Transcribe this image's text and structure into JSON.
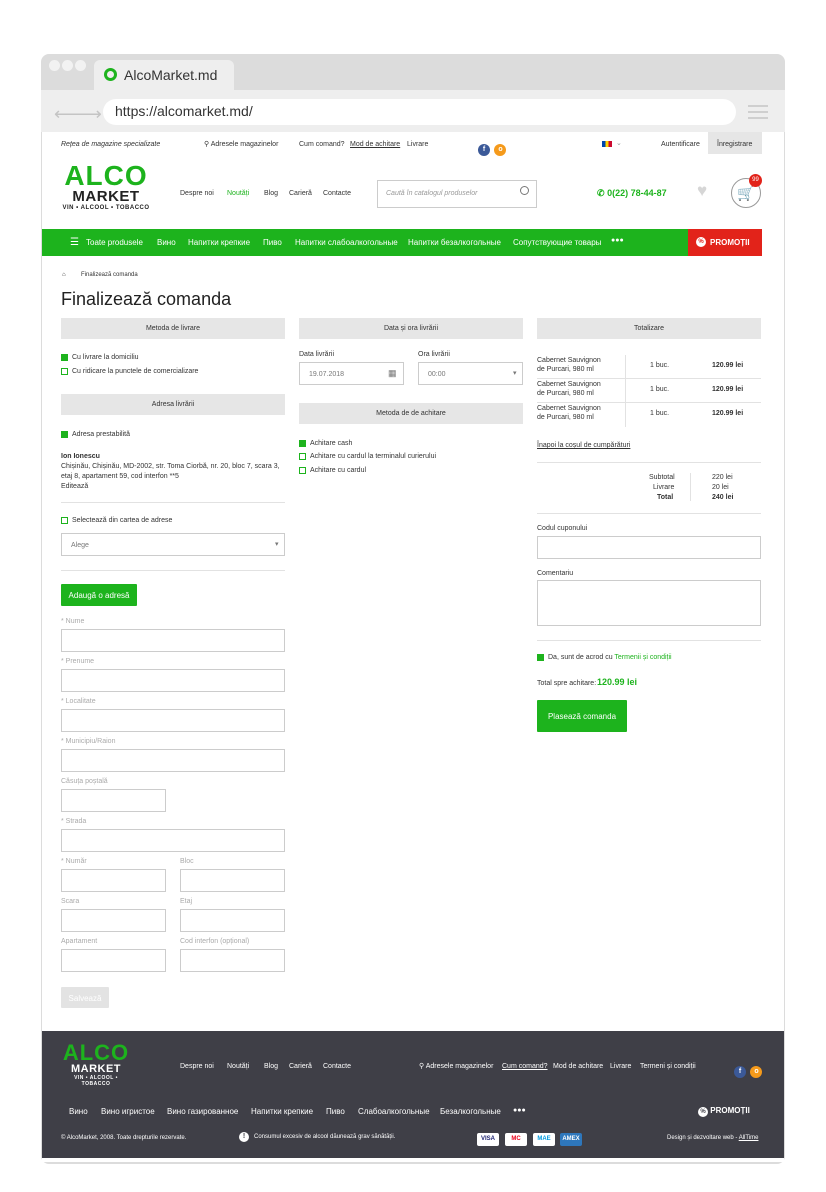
{
  "browser": {
    "tab_title": "AlcoMarket.md",
    "url": "https://alcomarket.md/"
  },
  "topbar": {
    "tagline": "Rețea de magazine specializate",
    "stores": "Adresele magazinelor",
    "links": [
      "Cum comand?",
      "Mod de achitare",
      "Livrare"
    ],
    "login": "Autentificare",
    "register": "Înregistrare"
  },
  "logo": {
    "alco": "ALCO",
    "market": "MARKET",
    "sub": "VIN • ALCOOL • TOBACCO"
  },
  "header": {
    "nav": [
      "Despre noi",
      "Noutăți",
      "Blog",
      "Carieră",
      "Contacte"
    ],
    "search_placeholder": "Caută în catalogul produselor",
    "phone": "0(22) 78-44-87",
    "cart_count": "99"
  },
  "menu": {
    "all_products": "Toate produsele",
    "items": [
      "Вино",
      "Напитки крепкие",
      "Пиво",
      "Напитки слабоалкогольные",
      "Напитки безалкогольные",
      "Сопутствующие товары"
    ],
    "more": "●●●",
    "promo": "PROMOȚII"
  },
  "breadcrumb": {
    "current": "Finalizează comanda"
  },
  "page_title": "Finalizează comanda",
  "delivery": {
    "header": "Metoda de livrare",
    "options": [
      "Cu livrare la domiciliu",
      "Cu ridicare la punctele de comercializare"
    ],
    "address_header": "Adresa livrării",
    "default_address": "Adresa prestabilită",
    "name": "Ion Ionescu",
    "address_lines": [
      "Chișinău, Chișinău, MD-2002, str. Toma Ciorbă, nr. 20, bloc 7, scara 3,",
      "etaj 8, apartament 59, cod interfon **5"
    ],
    "edit": "Editează",
    "select_book": "Selectează din cartea de adrese",
    "select_value": "Alege",
    "add_address": "Adaugă o adresă",
    "fields": {
      "nume": "* Nume",
      "prenume": "* Prenume",
      "localitate": "* Localitate",
      "municipiu": "* Municipiu/Raion",
      "cutie": "Căsuța poștală",
      "strada": "* Strada",
      "numar": "* Număr",
      "bloc": "Bloc",
      "scara": "Scara",
      "etaj": "Etaj",
      "apartament": "Apartament",
      "cod": "Cod interfon (opțional)"
    },
    "save": "Salvează"
  },
  "datetime": {
    "header": "Data și ora livrării",
    "date_label": "Data livrării",
    "date_value": "19.07.2018",
    "time_label": "Ora livrării",
    "time_value": "00:00"
  },
  "payment": {
    "header": "Metoda de de achitare",
    "options": [
      "Achitare cash",
      "Achitare cu cardul la terminalul curierului",
      "Achitare cu cardul"
    ]
  },
  "summary": {
    "header": "Totalizare",
    "items": [
      {
        "name1": "Cabernet Sauvignon",
        "name2": "de Purcari, 980 ml",
        "qty": "1 buc.",
        "price": "120.99 lei"
      },
      {
        "name1": "Cabernet Sauvignon",
        "name2": "de Purcari, 980 ml",
        "qty": "1 buc.",
        "price": "120.99 lei"
      },
      {
        "name1": "Cabernet Sauvignon",
        "name2": "de Purcari, 980 ml",
        "qty": "1 buc.",
        "price": "120.99 lei"
      }
    ],
    "back": "Înapoi la coșul de cumpărături",
    "subtotal_label": "Subtotal",
    "subtotal": "220 lei",
    "delivery_label": "Livrare",
    "delivery": "20 lei",
    "total_label": "Total",
    "total": "240 lei",
    "coupon_label": "Codul cuponului",
    "comment_label": "Comentariu",
    "agree_text": "Da, sunt de acrod cu ",
    "terms": "Termenii și condiții",
    "pay_total_label": "Total spre achitare:",
    "pay_total": "120.99 lei",
    "place_order": "Plasează comanda"
  },
  "footer": {
    "nav": [
      "Despre noi",
      "Noutăți",
      "Blog",
      "Carieră",
      "Contacte"
    ],
    "stores": "Adresele magazinelor",
    "links": [
      "Cum comand?",
      "Mod de achitare",
      "Livrare",
      "Termeni și condiții"
    ],
    "categories": [
      "Вино",
      "Вино игристое",
      "Вино газированное",
      "Напитки крепкие",
      "Пиво",
      "Слабоалкогольные",
      "Безалкогольные"
    ],
    "more": "●●●",
    "promo": "PROMOȚII",
    "copyright": "© AlcoMarket, 2008. Toate drepturile rezervate.",
    "warning": "Consumul excesiv de alcool dăunează grav sănătății.",
    "cards": [
      "VISA",
      "MC",
      "MAE",
      "AMEX"
    ],
    "design": "Design și dezvoltare web - ",
    "design_link": "AllTime"
  },
  "colors": {
    "brand_green": "#1db31d",
    "promo_red": "#e2231a",
    "footer_bg": "#3f3f47"
  }
}
